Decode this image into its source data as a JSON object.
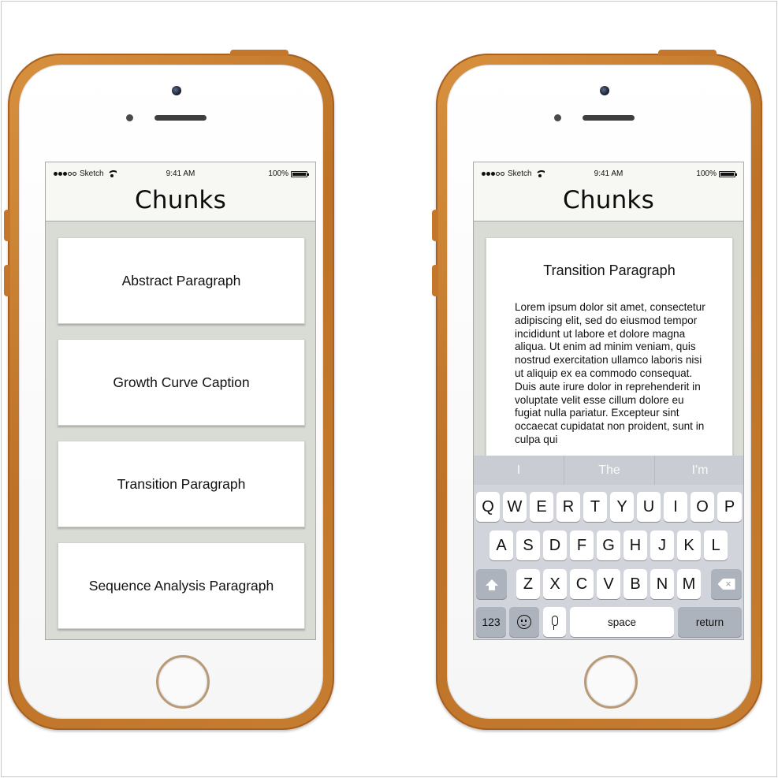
{
  "status_bar": {
    "carrier": "Sketch",
    "time": "9:41 AM",
    "battery": "100%"
  },
  "app": {
    "title": "Chunks"
  },
  "list_screen": {
    "cards": [
      {
        "label": "Abstract Paragraph"
      },
      {
        "label": "Growth Curve Caption"
      },
      {
        "label": "Transition Paragraph"
      },
      {
        "label": "Sequence Analysis Paragraph"
      }
    ]
  },
  "detail_screen": {
    "title": "Transition Paragraph",
    "body": "Lorem ipsum dolor sit amet, consectetur adipiscing elit, sed do eiusmod tempor incididunt ut labore et dolore magna aliqua. Ut enim ad minim veniam, quis nostrud exercitation ullamco laboris nisi ut aliquip ex ea commodo consequat. Duis aute irure dolor in reprehenderit in voluptate velit esse cillum dolore eu fugiat nulla pariatur. Excepteur sint occaecat cupidatat non proident, sunt in culpa qui"
  },
  "keyboard": {
    "suggestions": [
      "I",
      "The",
      "I'm"
    ],
    "row1": [
      "Q",
      "W",
      "E",
      "R",
      "T",
      "Y",
      "U",
      "I",
      "O",
      "P"
    ],
    "row2": [
      "A",
      "S",
      "D",
      "F",
      "G",
      "H",
      "J",
      "K",
      "L"
    ],
    "row3": [
      "Z",
      "X",
      "C",
      "V",
      "B",
      "N",
      "M"
    ],
    "numbers_label": "123",
    "space_label": "space",
    "return_label": "return",
    "shift_icon": "shift-icon",
    "backspace_icon": "backspace-icon",
    "emoji_icon": "emoji-icon",
    "mic_icon": "microphone-icon"
  },
  "colors": {
    "case_orange": "#c77d30",
    "screen_bg": "#d9dcd4",
    "keyboard_bg": "#d1d5db"
  }
}
